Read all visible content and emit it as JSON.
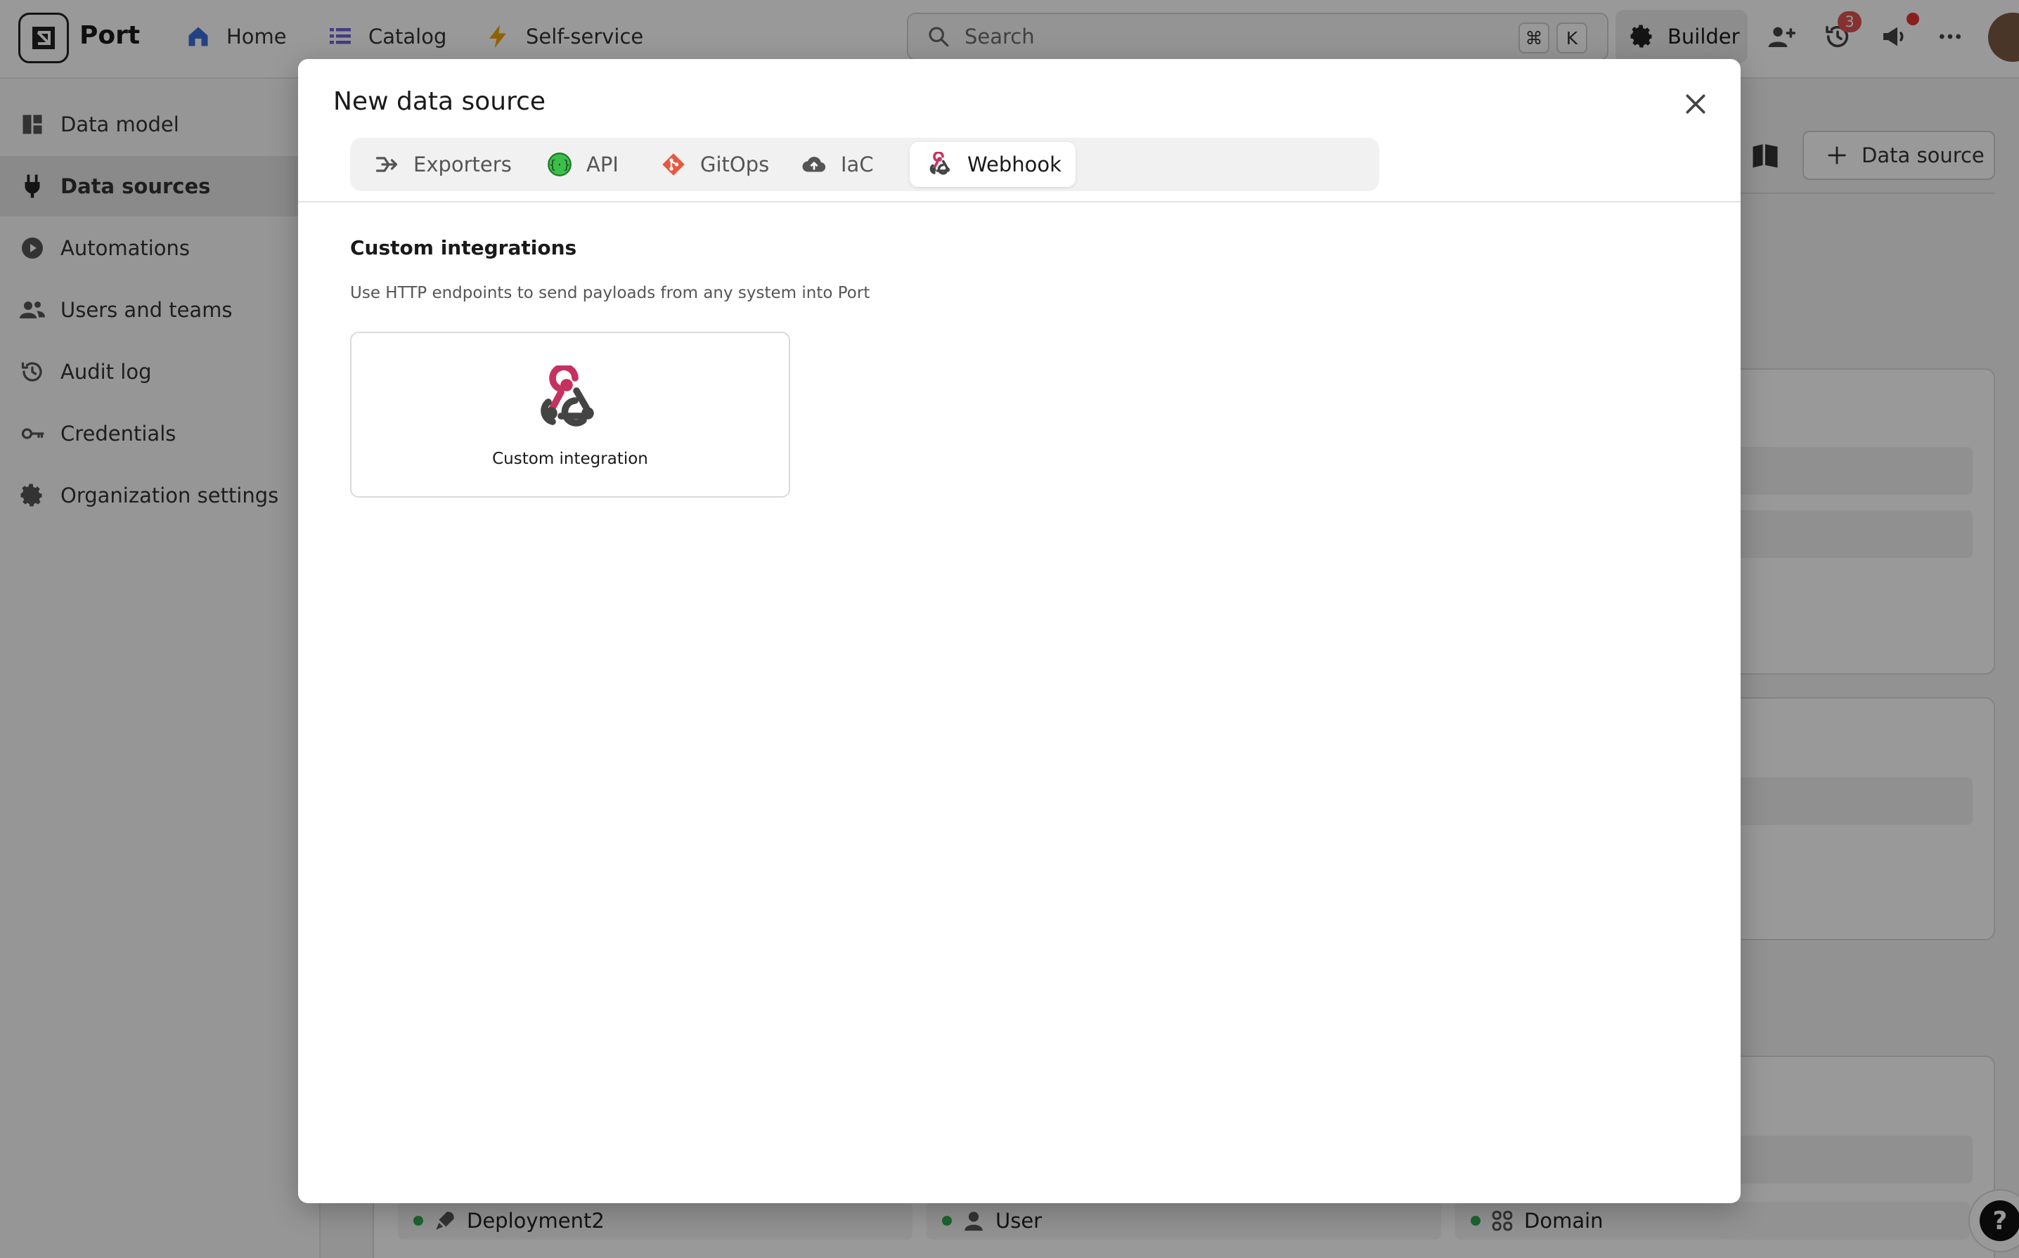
{
  "topbar": {
    "app_name": "Port",
    "nav": [
      {
        "label": "Home",
        "icon": "home-icon"
      },
      {
        "label": "Catalog",
        "icon": "list-icon"
      },
      {
        "label": "Self-service",
        "icon": "lightning-icon"
      }
    ],
    "search_placeholder": "Search",
    "shortcut_keys": [
      "⌘",
      "K"
    ],
    "builder_label": "Builder",
    "notifications_count": "3"
  },
  "sidebar": {
    "items": [
      {
        "label": "Data model",
        "icon": "dashboard-icon"
      },
      {
        "label": "Data sources",
        "icon": "plug-icon",
        "active": true
      },
      {
        "label": "Automations",
        "icon": "play-circle-icon"
      },
      {
        "label": "Users and teams",
        "icon": "users-icon"
      },
      {
        "label": "Audit log",
        "icon": "history-icon"
      },
      {
        "label": "Credentials",
        "icon": "key-icon"
      },
      {
        "label": "Organization settings",
        "icon": "gear-icon"
      }
    ]
  },
  "page": {
    "add_button_label": "Data source",
    "entities": [
      {
        "label": "Deployment2",
        "icon": "rocket-icon"
      },
      {
        "label": "User",
        "icon": "user-icon"
      },
      {
        "label": "Domain",
        "icon": "domain-icon"
      }
    ],
    "help_label": "?"
  },
  "modal": {
    "title": "New data source",
    "tabs": [
      {
        "label": "Exporters",
        "icon": "exporter-icon"
      },
      {
        "label": "API",
        "icon": "api-icon"
      },
      {
        "label": "GitOps",
        "icon": "git-icon"
      },
      {
        "label": "IaC",
        "icon": "cloud-upload-icon"
      },
      {
        "label": "Webhook",
        "icon": "webhook-icon",
        "active": true
      }
    ],
    "section": {
      "title": "Custom integrations",
      "description": "Use HTTP endpoints to send payloads from any system into Port"
    },
    "cards": [
      {
        "label": "Custom integration",
        "icon": "webhook-icon"
      }
    ]
  },
  "colors": {
    "accent_blue": "#3b6fd8",
    "catalog_purple": "#6e63d9",
    "self_service_orange": "#f0a30a",
    "api_green": "#3cbf4a",
    "git_red": "#e9573f",
    "webhook_pink": "#c5325f",
    "status_green": "#2fa84f",
    "badge_red": "#e05252"
  }
}
